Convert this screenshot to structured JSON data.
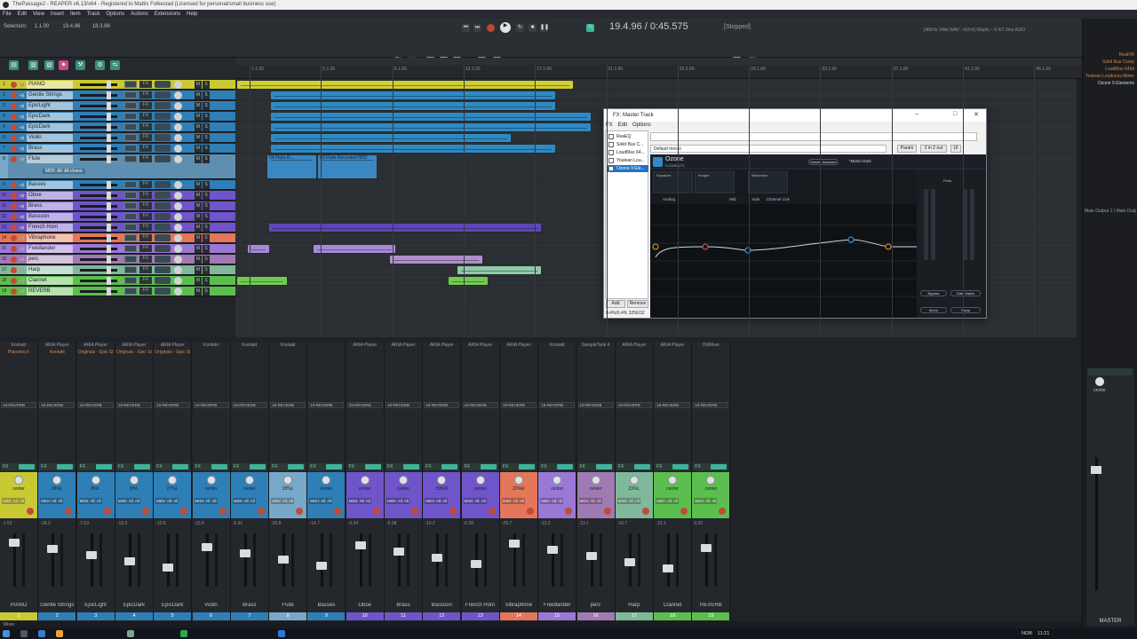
{
  "window": {
    "title": "ThePassage2 - REAPER v6.13/x64 - Registered to Mattis Folkestad (Licensed for personal/small business use)"
  },
  "menu": [
    "File",
    "Edit",
    "View",
    "Insert",
    "Item",
    "Track",
    "Options",
    "Actions",
    "Extensions",
    "Help"
  ],
  "transport": {
    "selection_label": "Selection:",
    "sel_start": "1.1.00",
    "sel_end": "19.4.96",
    "sel_len": "18.3.96",
    "position": "19.4.96 / 0:45.575",
    "status": "[Stopped]",
    "hwinfo": "[48kHz 24bit WAV : 4/2ch] 96spls ~ 5.4/7.3ms ASIO"
  },
  "ruler": [
    "1.1.00",
    "5.1.00",
    "9.1.00",
    "13.1.00",
    "17.1.00",
    "21.1.00",
    "25.1.00",
    "29.1.00",
    "33.1.00",
    "37.1.00",
    "41.1.00",
    "45.1.00"
  ],
  "tracks": [
    {
      "n": "1",
      "name": "PIANO",
      "color": "#c9c934"
    },
    {
      "n": "2",
      "name": "Gentle Strings",
      "color": "#2f7fb7"
    },
    {
      "n": "3",
      "name": "EpicLight",
      "color": "#2f7fb7"
    },
    {
      "n": "4",
      "name": "EpicDark",
      "color": "#2f7fb7"
    },
    {
      "n": "5",
      "name": "EpicDark",
      "color": "#2f7fb7"
    },
    {
      "n": "6",
      "name": "Violin",
      "color": "#2f7fb7"
    },
    {
      "n": "7",
      "name": "Brass",
      "color": "#2f7fb7"
    },
    {
      "n": "8",
      "name": "Flute",
      "color": "#78a8c8"
    },
    {
      "n": "9",
      "name": "Basses",
      "color": "#2f7fb7"
    },
    {
      "n": "10",
      "name": "Oboe",
      "color": "#6f55c9"
    },
    {
      "n": "11",
      "name": "Brass",
      "color": "#6f55c9"
    },
    {
      "n": "12",
      "name": "Bassoon",
      "color": "#6f55c9"
    },
    {
      "n": "13",
      "name": "French Horn",
      "color": "#6f55c9"
    },
    {
      "n": "14",
      "name": "Vibraphone",
      "color": "#e4765a"
    },
    {
      "n": "15",
      "name": "Freidlander",
      "color": "#9a78d6"
    },
    {
      "n": "16",
      "name": "perc",
      "color": "#a07ab3"
    },
    {
      "n": "17",
      "name": "Harp",
      "color": "#7fb89a"
    },
    {
      "n": "18",
      "name": "Clarinet",
      "color": "#5cbe4e"
    },
    {
      "n": "19",
      "name": "REVERB",
      "color": "#5cbe4e"
    }
  ],
  "flute_midi": "MIDI: All: All chann",
  "items": [
    {
      "label": "",
      "lane": 0
    },
    {
      "label": "04-Flute-R...",
      "lane": 8
    },
    {
      "label": "03-Flute-Recorded MIDI",
      "lane": 8
    }
  ],
  "fx_window": {
    "title": "FX: Master Track",
    "menu": [
      "FX",
      "Edit",
      "Options"
    ],
    "plugins": [
      {
        "name": "ReaEQ",
        "on": false
      },
      {
        "name": "Solid Bus C...",
        "on": false
      },
      {
        "name": "LoudMax 64...",
        "on": false
      },
      {
        "name": "Youlean Lou...",
        "on": false
      },
      {
        "name": "Ozone 9 Ele...",
        "on": true
      }
    ],
    "preset": "Default mosto",
    "param_btn": "Param",
    "io_btn": "2 in 2 out",
    "ui_btn": "UI",
    "add": "Add",
    "remove": "Remove",
    "cpu": "0.4%/0.4% 3256/32",
    "ozone": {
      "title": "Ozone",
      "subtitle": "ELEMENTS",
      "master_assistant": "Master Assistant",
      "preset": "*Mosto Dark",
      "modules": [
        "Equalizer",
        "Imager",
        "Maximizer"
      ],
      "eq_mode": "Analog",
      "stereo": "Mid",
      "side": "Side",
      "link": "Channel Link",
      "bypass": "Bypass",
      "gain_match": "Gain Match",
      "meter_label": "Peak",
      "mono": "Mono",
      "swap": "Swap"
    }
  },
  "right_panel": [
    "ReaFIR",
    "Solid Bus Comp",
    "LoudMax 64bit",
    "Youlean Loudness Meter",
    "Ozone 9 Elements"
  ],
  "right_io": "Main Output 1 / Main Output 2",
  "mixer": {
    "sends": [
      "19-REVERB"
    ],
    "strips": [
      {
        "plug": "Kontakt",
        "plug2": "Pianoteq 6",
        "pan": "center",
        "vol": "-1.53",
        "name": "PIANO",
        "num": "1",
        "color": "#c9c934"
      },
      {
        "plug": "ARIA Player",
        "plug2": "Kontakt",
        "pan": "26%L",
        "vol": "-18.3",
        "name": "Gentle Strings",
        "num": "2",
        "color": "#2f7fb7"
      },
      {
        "plug": "ARIA Player",
        "plug2": "Originals - Epic St",
        "pan": "8%L",
        "vol": "-7.53",
        "name": "EpicLight",
        "num": "3",
        "color": "#2f7fb7"
      },
      {
        "plug": "ARIA Player",
        "plug2": "Originals - Epic St",
        "pan": "9%L",
        "vol": "-10.3",
        "name": "EpicDark",
        "num": "4",
        "color": "#2f7fb7"
      },
      {
        "plug": "ARIA Player",
        "plug2": "Originals - Epic St",
        "pan": "27%L",
        "vol": "-10.6",
        "name": "EpicDark",
        "num": "5",
        "color": "#2f7fb7"
      },
      {
        "plug": "Kontakt",
        "plug2": "",
        "pan": "center",
        "vol": "-15.8",
        "name": "Violin",
        "num": "6",
        "color": "#2f7fb7"
      },
      {
        "plug": "Kontakt",
        "plug2": "",
        "pan": "center",
        "vol": "-5.91",
        "name": "Brass",
        "num": "7",
        "color": "#2f7fb7"
      },
      {
        "plug": "Kontakt",
        "plug2": "",
        "pan": "28%L",
        "vol": "-25.8",
        "name": "Flute",
        "num": "8",
        "color": "#78a8c8"
      },
      {
        "plug": "",
        "plug2": "",
        "pan": "center",
        "vol": "-14.7",
        "name": "Basses",
        "num": "9",
        "color": "#2f7fb7"
      },
      {
        "plug": "ARIA Player",
        "plug2": "",
        "pan": "center",
        "vol": "-6.24",
        "name": "Oboe",
        "num": "10",
        "color": "#6f55c9"
      },
      {
        "plug": "ARIA Player",
        "plug2": "",
        "pan": "center",
        "vol": "-5.98",
        "name": "Brass",
        "num": "11",
        "color": "#6f55c9"
      },
      {
        "plug": "ARIA Player",
        "plug2": "",
        "pan": "39%R",
        "vol": "-10.2",
        "name": "Bassoon",
        "num": "12",
        "color": "#6f55c9"
      },
      {
        "plug": "ARIA Player",
        "plug2": "",
        "pan": "center",
        "vol": "-6.38",
        "name": "French Horn",
        "num": "13",
        "color": "#6f55c9"
      },
      {
        "plug": "ARIA Player",
        "plug2": "",
        "pan": "22%R",
        "vol": "-25.7",
        "name": "Vibraphone",
        "num": "14",
        "color": "#e4765a"
      },
      {
        "plug": "Kontakt",
        "plug2": "",
        "pan": "center",
        "vol": "-13.2",
        "name": "Freidlander",
        "num": "15",
        "color": "#9a78d6"
      },
      {
        "plug": "SampleTank 4",
        "plug2": "",
        "pan": "center",
        "vol": "-13.1",
        "name": "perc",
        "num": "16",
        "color": "#a07ab3"
      },
      {
        "plug": "ARIA Player",
        "plug2": "",
        "pan": "23%L",
        "vol": "-16.7",
        "name": "Harp",
        "num": "17",
        "color": "#7fb89a"
      },
      {
        "plug": "ARIA Player",
        "plug2": "",
        "pan": "center",
        "vol": "-13.1",
        "name": "Clarinet",
        "num": "18",
        "color": "#5cbe4e"
      },
      {
        "plug": "OrilRiver",
        "plug2": "",
        "pan": "center",
        "vol": "0.00",
        "name": "REVERB",
        "num": "19",
        "color": "#5cbe4e"
      }
    ],
    "midi_label": "MIDI: All: All",
    "fx_label": "FX",
    "tab": "Mixer",
    "master_label": "MASTER",
    "master_pan": "center"
  },
  "taskbar": {
    "time": "11:21",
    "lang": "NOB"
  }
}
